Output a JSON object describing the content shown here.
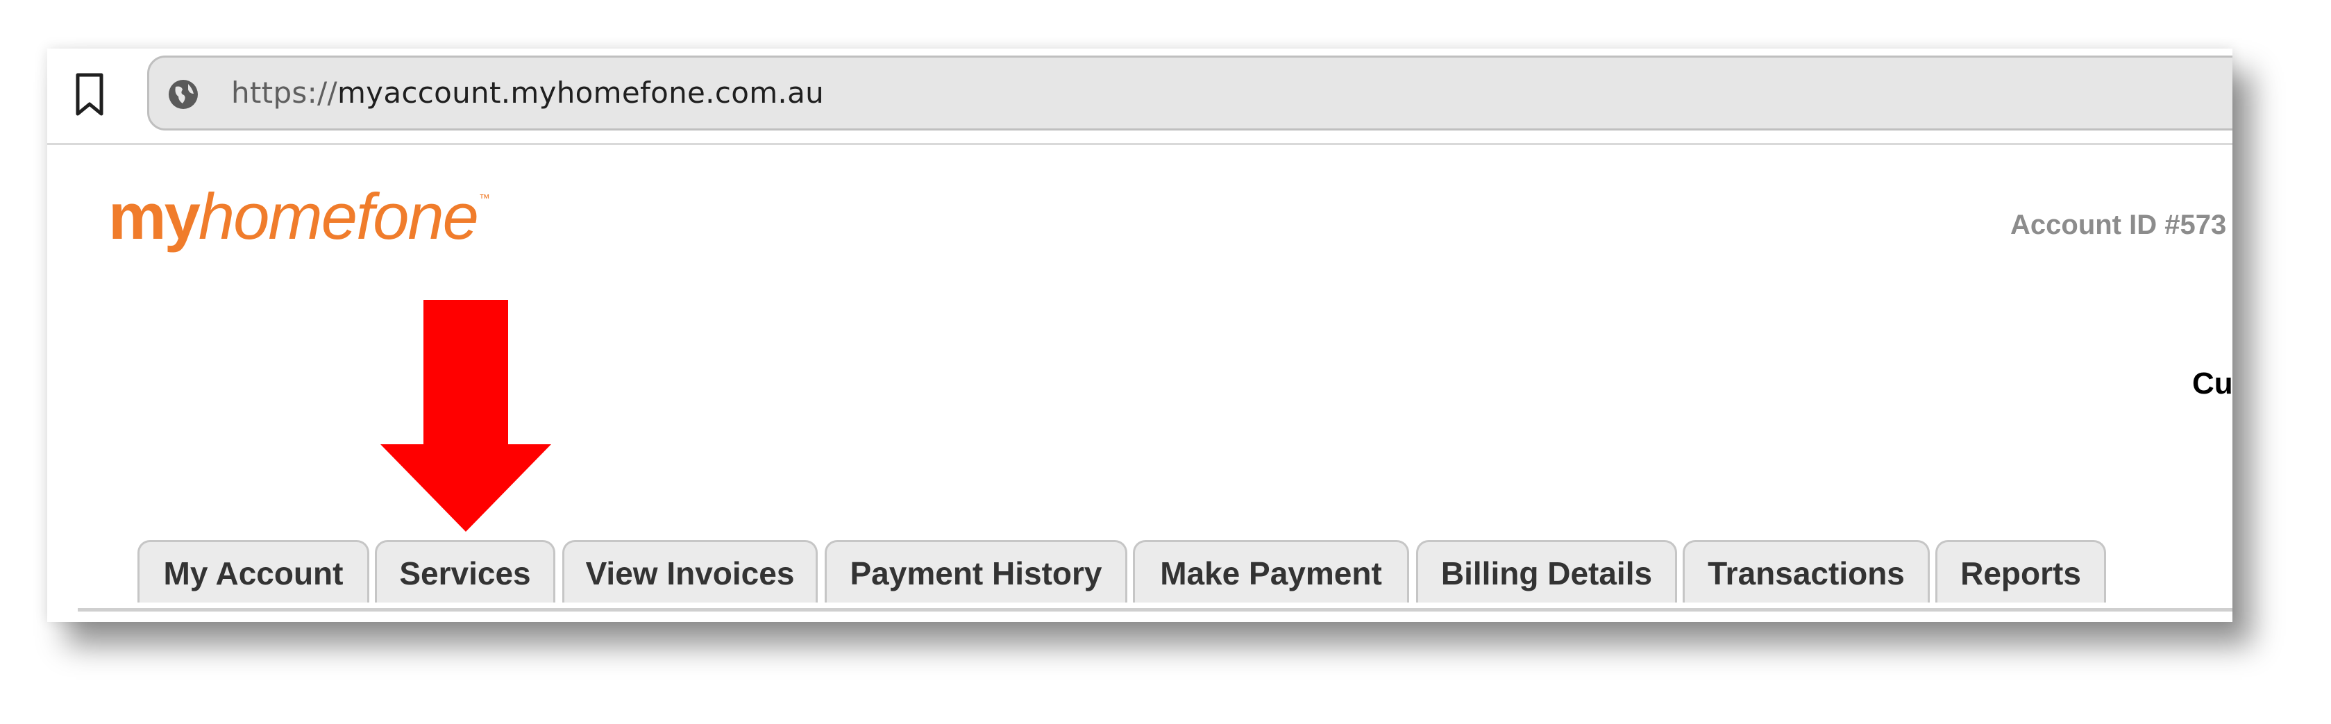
{
  "browser": {
    "url_scheme": "https://",
    "url_host": "myaccount.myhomefone.com.au"
  },
  "logo": {
    "part1": "my",
    "part2": "homefone",
    "tm": "™"
  },
  "header": {
    "account_id": "Account ID #573",
    "cu_text": "Cu"
  },
  "tabs": [
    {
      "label": "My Account"
    },
    {
      "label": "Services"
    },
    {
      "label": "View Invoices"
    },
    {
      "label": "Payment History"
    },
    {
      "label": "Make Payment"
    },
    {
      "label": "Billing Details"
    },
    {
      "label": "Transactions"
    },
    {
      "label": "Reports"
    }
  ],
  "colors": {
    "brand_orange": "#f07c2b",
    "arrow_red": "#ff0000",
    "tab_bg": "#ebebeb"
  },
  "icons": {
    "bookmark": "bookmark-icon",
    "site_info": "globe-icon",
    "annotation": "down-arrow-icon"
  }
}
